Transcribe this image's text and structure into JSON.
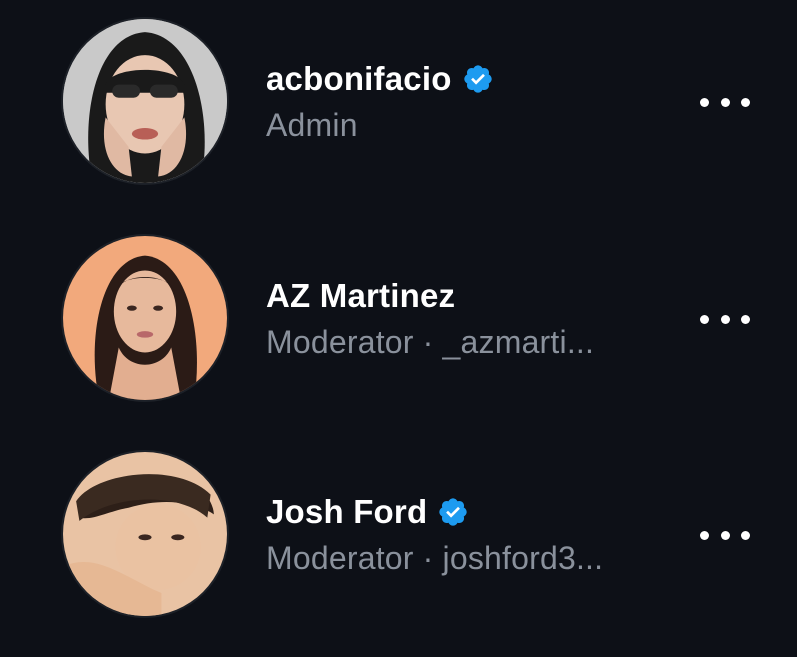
{
  "colors": {
    "background": "#0d1017",
    "name": "#ffffff",
    "subtitle": "#8a919c",
    "verified": "#1d9bf0"
  },
  "members": [
    {
      "name": "acbonifacio",
      "verified": true,
      "role": "Admin",
      "handle": "",
      "avatar_icon": "avatar-photo",
      "more_icon": "more-horizontal-icon"
    },
    {
      "name": "AZ Martinez",
      "verified": false,
      "role": "Moderator",
      "separator": "·",
      "handle": "_azmarti...",
      "avatar_icon": "avatar-photo",
      "more_icon": "more-horizontal-icon"
    },
    {
      "name": "Josh Ford",
      "verified": true,
      "role": "Moderator",
      "separator": "·",
      "handle": "joshford3...",
      "avatar_icon": "avatar-photo",
      "more_icon": "more-horizontal-icon"
    }
  ]
}
